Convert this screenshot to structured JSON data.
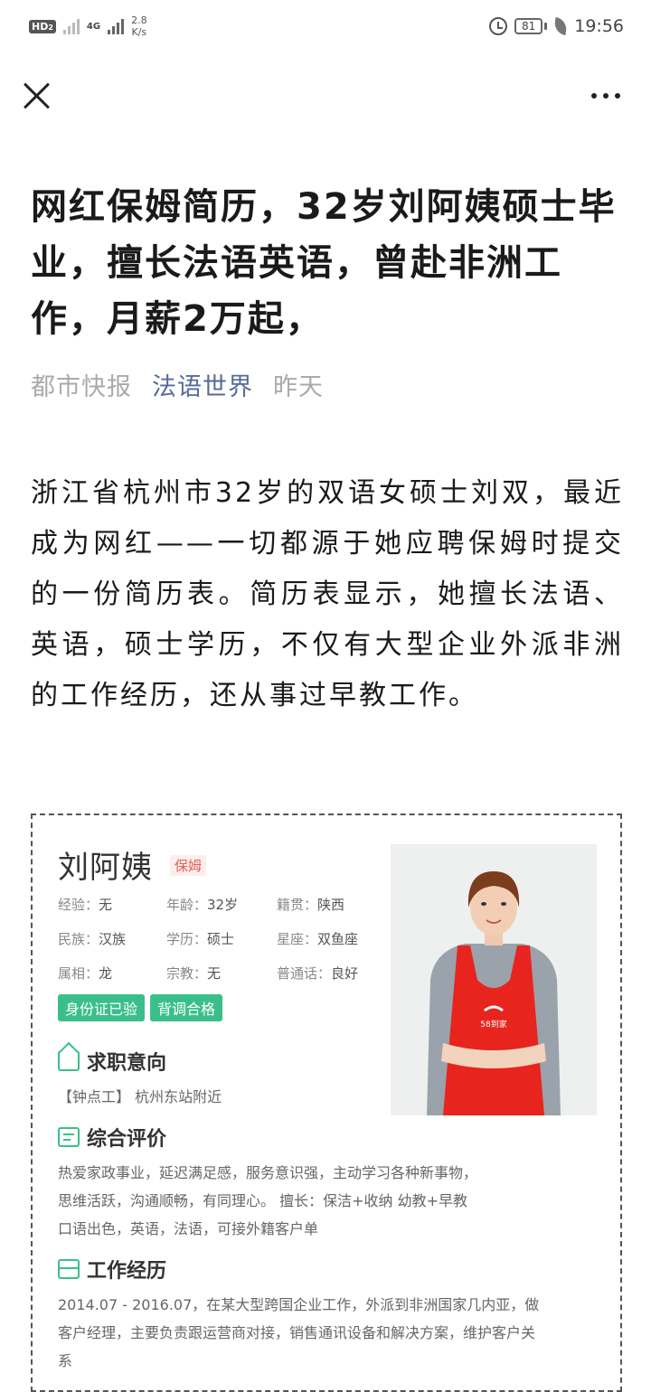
{
  "status_bar": {
    "hd_label": "HD",
    "hd_sub": "2",
    "network": "4G",
    "speed_value": "2.8",
    "speed_unit": "K/s",
    "battery": "81",
    "time": "19:56"
  },
  "article": {
    "title": "网红保姆简历，32岁刘阿姨硕士毕业，擅长法语英语，曾赴非洲工作，月薪2万起，",
    "source": "都市快报",
    "account": "法语世界",
    "date": "昨天",
    "intro": "浙江省杭州市32岁的双语女硕士刘双，最近成为网红——一切都源于她应聘保姆时提交的一份简历表。简历表显示，她擅长法语、英语，硕士学历，不仅有大型企业外派非洲的工作经历，还从事过早教工作。"
  },
  "resume": {
    "name": "刘阿姨",
    "tag": "保姆",
    "fields": [
      {
        "label": "经验：",
        "value": "无"
      },
      {
        "label": "年龄：",
        "value": "32岁"
      },
      {
        "label": "籍贯：",
        "value": "陕西"
      },
      {
        "label": "民族：",
        "value": "汉族"
      },
      {
        "label": "学历：",
        "value": "硕士"
      },
      {
        "label": "星座：",
        "value": "双鱼座"
      },
      {
        "label": "属相：",
        "value": "龙"
      },
      {
        "label": "宗教：",
        "value": "无"
      },
      {
        "label": "普通话：",
        "value": "良好"
      }
    ],
    "badges": [
      "身份证已验",
      "背调合格"
    ],
    "job_intent_title": "求职意向",
    "job_intent_text": "【钟点工】 杭州东站附近",
    "eval_title": "综合评价",
    "eval_lines": [
      "热爱家政事业，延迟满足感，服务意识强，主动学习各种新事物，",
      "思维活跃，沟通顺畅，有同理心。 擅长：保洁+收纳 幼教+早教",
      "口语出色，英语，法语，可接外籍客户单"
    ],
    "work_title": "工作经历",
    "work_lines": [
      "2014.07 - 2016.07，在某大型跨国企业工作，外派到非洲国家几内亚，做",
      "客户经理，主要负责跟运营商对接，销售通讯设备和解决方案，维护客户关",
      "系"
    ],
    "apron_logo": "58到家"
  },
  "colors": {
    "account_link": "#576b95",
    "badge_green": "#3bbf8a",
    "tag_red": "#e06055"
  }
}
